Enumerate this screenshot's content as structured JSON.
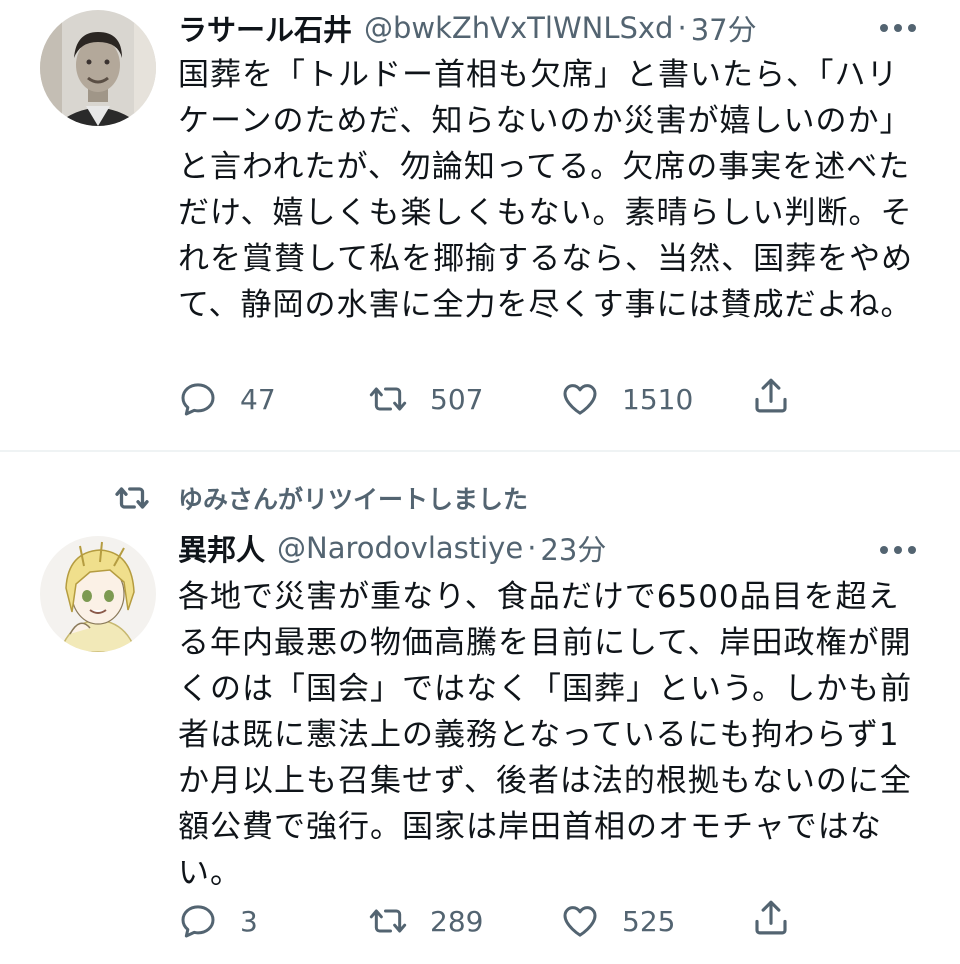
{
  "tweets": [
    {
      "display_name": "ラサール石井",
      "handle": "@bwkZhVxTlWNLSxd",
      "dot": "·",
      "time": "37分",
      "text": "国葬を「トルドー首相も欠席」と書いたら、「ハリケーンのためだ、知らないのか災害が嬉しいのか」と言われたが、勿論知ってる。欠席の事実を述べただけ、嬉しくも楽しくもない。素晴らしい判断。それを賞賛して私を揶揄するなら、当然、国葬をやめて、静岡の水害に全力を尽くす事には賛成だよね。",
      "replies": "47",
      "retweets": "507",
      "likes": "1510"
    },
    {
      "retweeted_by": "ゆみさんがリツイートしました",
      "display_name": "異邦人",
      "handle": "@Narodovlastiye",
      "dot": "·",
      "time": "23分",
      "text": "各地で災害が重なり、食品だけで6500品目を超える年内最悪の物価高騰を目前にして、岸田政権が開くのは「国会」ではなく「国葬」という。しかも前者は既に憲法上の義務となっているにも拘わらず1か月以上も召集せず、後者は法的根拠もないのに全額公費で強行。国家は岸田首相のオモチャではない。",
      "replies": "3",
      "retweets": "289",
      "likes": "525"
    }
  ],
  "icons": {
    "reply": "reply-icon",
    "retweet": "retweet-icon",
    "like": "heart-icon",
    "share": "share-icon",
    "more": "more-icon"
  },
  "colors": {
    "text": "#0f1419",
    "secondary": "#536471",
    "divider": "#eff3f4"
  }
}
